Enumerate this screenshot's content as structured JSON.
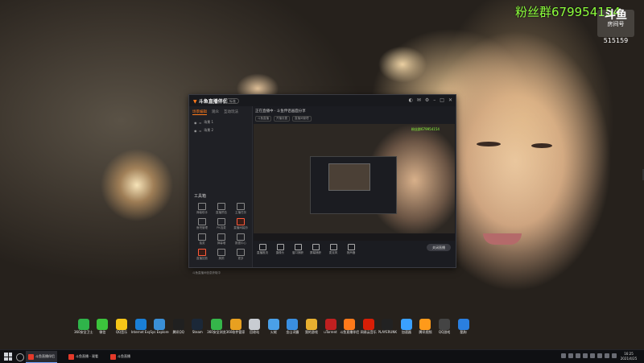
{
  "overlay": {
    "fan_group": "粉丝群679954154",
    "room_logo": "斗鱼",
    "room_label": "房间号",
    "room_id": "515159"
  },
  "app": {
    "logo": "斗鱼直播伴侣",
    "version_pill": "标准",
    "side_tabs": [
      "场景编辑",
      "观众",
      "互动玩法"
    ],
    "scenes": [
      "场景 1",
      "场景 2"
    ],
    "tools_title": "工具箱",
    "tools": [
      "弹幕助手",
      "直播预告",
      "主播任务",
      "鱼吧管理",
      "PK连麦",
      "直播间装扮",
      "抽奖",
      "弹幕墙",
      "数据中心",
      "直播回放",
      "美颜",
      "更多"
    ],
    "header_title": "正在直播中 · 斗鱼伴侣画面分享",
    "tags": [
      "斗鱼直播",
      "开播设置",
      "直播间管理"
    ],
    "preview_green": "粉丝群679954154",
    "controls": [
      "直播推流",
      "摄像头",
      "窗口捕获",
      "屏幕捕获",
      "麦克风",
      "扬声器"
    ],
    "live_button": "关闭直播",
    "status": "斗鱼直播间信息获取中"
  },
  "desktop_icons": [
    {
      "label": "360安全卫士",
      "color": "#2fb44a"
    },
    {
      "label": "微信",
      "color": "#3cc33c"
    },
    {
      "label": "QQ音乐",
      "color": "#f5c518"
    },
    {
      "label": "Internet Explorer",
      "color": "#1a7fd6"
    },
    {
      "label": "Sys Explorer",
      "color": "#3a8fd6"
    },
    {
      "label": "腾讯QQ",
      "color": "#202020"
    },
    {
      "label": "Steam",
      "color": "#1b2838"
    },
    {
      "label": "360安全浏览器",
      "color": "#35b64a"
    },
    {
      "label": "360软件管家",
      "color": "#e8a020"
    },
    {
      "label": "回收站",
      "color": "#c8ccd2"
    },
    {
      "label": "火绒",
      "color": "#4aa0e8"
    },
    {
      "label": "金山词霸",
      "color": "#3a8fe0"
    },
    {
      "label": "我的游戏",
      "color": "#e8b030"
    },
    {
      "label": "uTorrent",
      "color": "#c02020"
    },
    {
      "label": "斗鱼直播伴侣",
      "color": "#ff7a1a"
    },
    {
      "label": "网易云音乐",
      "color": "#d81e06"
    },
    {
      "label": "PLAYERUNKNOWN'S",
      "color": "#222"
    },
    {
      "label": "加速器",
      "color": "#3aa0ff"
    },
    {
      "label": "腾讯视频",
      "color": "#ff9a1a"
    },
    {
      "label": "QQ游戏",
      "color": "#444"
    },
    {
      "label": "酷狗",
      "color": "#2a7fe0"
    }
  ],
  "taskbar": {
    "items": [
      {
        "label": "斗鱼直播伴侣",
        "active": true
      },
      {
        "label": "斗鱼直播 - 观看",
        "active": false
      },
      {
        "label": "斗鱼直播",
        "active": false
      }
    ],
    "time": "16:25",
    "date": "2021/4/25"
  }
}
